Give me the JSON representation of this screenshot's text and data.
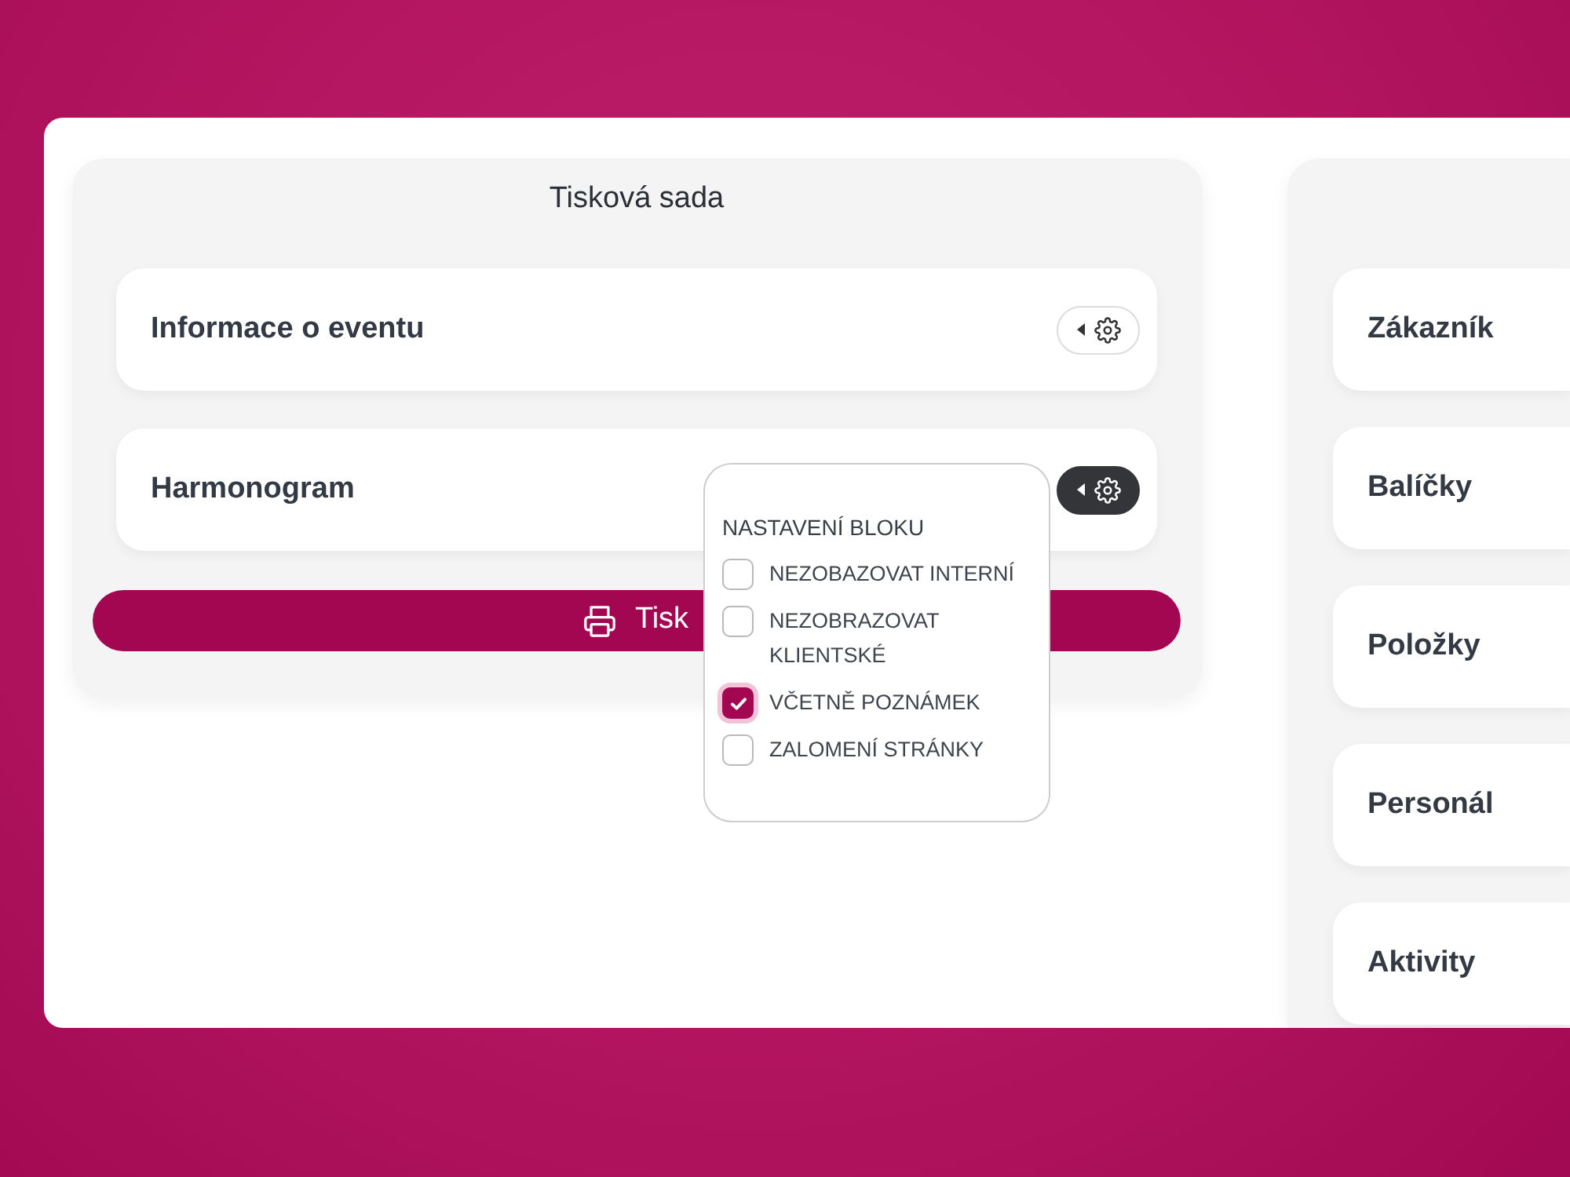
{
  "print_set": {
    "title": "Tisková sada",
    "blocks": [
      {
        "label": "Informace o eventu",
        "settings_open": false
      },
      {
        "label": "Harmonogram",
        "settings_open": true
      }
    ],
    "print_button": "Tisk"
  },
  "block_settings": {
    "title": "NASTAVENÍ BLOKU",
    "options": [
      {
        "label": "NEZOBAZOVAT INTERNÍ",
        "checked": false
      },
      {
        "label": "NEZOBRAZOVAT KLIENTSKÉ",
        "checked": false
      },
      {
        "label": "VČETNĚ POZNÁMEK",
        "checked": true
      },
      {
        "label": "ZALOMENÍ STRÁNKY",
        "checked": false
      }
    ]
  },
  "sections": {
    "items": [
      {
        "label": "Zákazník"
      },
      {
        "label": "Balíčky"
      },
      {
        "label": "Položky"
      },
      {
        "label": "Personál"
      },
      {
        "label": "Aktivity"
      }
    ]
  }
}
